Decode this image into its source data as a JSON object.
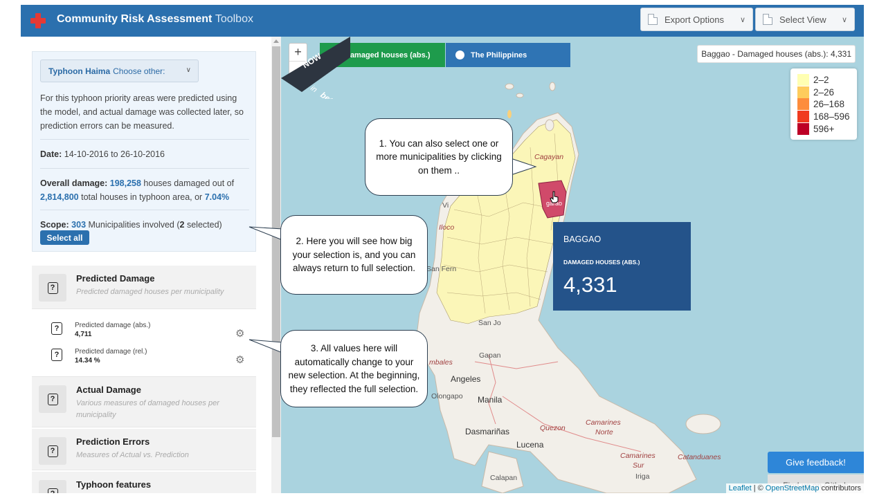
{
  "header": {
    "title_bold": "Community Risk Assessment",
    "title_thin": "Toolbox",
    "export_label": "Export Options",
    "view_label": "Select View"
  },
  "info": {
    "typhoon_name": "Typhoon Haima",
    "typhoon_other": "Choose other:",
    "description": "For this typhoon priority areas were predicted using the model, and actual damage was collected later, so prediction errors can be measured.",
    "date_label": "Date:",
    "date_value": "14-10-2016 to 26-10-2016",
    "damage_label": "Overall damage:",
    "damage_houses": "198,258",
    "damage_text1": "houses damaged out of",
    "total_houses": "2,814,800",
    "damage_text2": "total houses in typhoon area, or",
    "damage_pct": "7.04%",
    "scope_label": "Scope:",
    "scope_count": "303",
    "scope_text": "Municipalities involved (",
    "scope_selected": "2",
    "scope_text2": "selected)",
    "select_all": "Select all"
  },
  "sections": {
    "predicted_title": "Predicted Damage",
    "predicted_sub": "Predicted damaged houses per municipality",
    "pred_abs_label": "Predicted damage (abs.)",
    "pred_abs_value": "4,711",
    "pred_rel_label": "Predicted damage (rel.)",
    "pred_rel_value": "14.34 %",
    "actual_title": "Actual Damage",
    "actual_sub": "Various measures of damaged houses per municipality",
    "errors_title": "Prediction Errors",
    "errors_sub": "Measures of Actual vs. Prediction",
    "typhoon_title": "Typhoon features"
  },
  "map": {
    "tab_damage": "Damaged houses (abs.)",
    "tab_country": "The Philippines",
    "hover_info": "Baggao - Damaged houses (abs.): 4,331",
    "legend": [
      {
        "label": "2–2",
        "color": "#ffffb2"
      },
      {
        "label": "2–26",
        "color": "#fecc5c"
      },
      {
        "label": "26–168",
        "color": "#fd8d3c"
      },
      {
        "label": "168–596",
        "color": "#f03b20"
      },
      {
        "label": "596+",
        "color": "#bd0026"
      }
    ],
    "popup_name": "BAGGAO",
    "popup_label": "DAMAGED HOUSES (ABS.)",
    "popup_value": "4,331",
    "beta_now": "NOW",
    "beta_in": "in",
    "beta_word": "beta!",
    "feedback": "Give feedback!",
    "github": "Find us on Github",
    "attrib_leaflet": "Leaflet",
    "attrib_sep": "| ©",
    "attrib_osm": "OpenStreetMap",
    "attrib_contrib": "contributors",
    "labels": {
      "cagayan": "Cagayan",
      "vi": "Vi",
      "ilocos": "Iloco",
      "sanfern": "San Fern",
      "sanjo": "San Jo",
      "gapan": "Gapan",
      "ambales": "mbales",
      "angeles": "Angeles",
      "olongapo": "Olongapo",
      "manila": "Manila",
      "dasmarinas": "Dasmariñas",
      "lucena": "Lucena",
      "quezon": "Quezon",
      "camarines": "Camarines",
      "norte": "Norte",
      "camarines2": "Camarines",
      "sur": "Sur",
      "catanduanes": "Catanduanes",
      "iriga": "Iriga",
      "calapan": "Calapan",
      "tuguegarao": "garao"
    }
  },
  "bubbles": {
    "b1": "1. You can also select one or more municipalities by clicking on them ..",
    "b2": "2. Here you will see how big your selection is, and you can always return to full selection.",
    "b3": "3. All values here will automatically change to your new selection. At the beginning, they reflected the full selection."
  },
  "colors": {
    "header": "#2b70ae",
    "popup": "#24538a",
    "tab_green": "#1e9b4c",
    "tab_blue": "#2f74b4"
  }
}
